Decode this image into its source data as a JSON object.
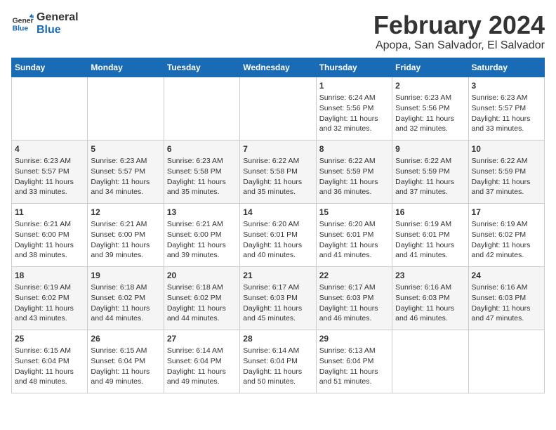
{
  "logo": {
    "line1": "General",
    "line2": "Blue"
  },
  "title": "February 2024",
  "subtitle": "Apopa, San Salvador, El Salvador",
  "days_of_week": [
    "Sunday",
    "Monday",
    "Tuesday",
    "Wednesday",
    "Thursday",
    "Friday",
    "Saturday"
  ],
  "weeks": [
    [
      {
        "day": "",
        "content": ""
      },
      {
        "day": "",
        "content": ""
      },
      {
        "day": "",
        "content": ""
      },
      {
        "day": "",
        "content": ""
      },
      {
        "day": "1",
        "content": "Sunrise: 6:24 AM\nSunset: 5:56 PM\nDaylight: 11 hours and 32 minutes."
      },
      {
        "day": "2",
        "content": "Sunrise: 6:23 AM\nSunset: 5:56 PM\nDaylight: 11 hours and 32 minutes."
      },
      {
        "day": "3",
        "content": "Sunrise: 6:23 AM\nSunset: 5:57 PM\nDaylight: 11 hours and 33 minutes."
      }
    ],
    [
      {
        "day": "4",
        "content": "Sunrise: 6:23 AM\nSunset: 5:57 PM\nDaylight: 11 hours and 33 minutes."
      },
      {
        "day": "5",
        "content": "Sunrise: 6:23 AM\nSunset: 5:57 PM\nDaylight: 11 hours and 34 minutes."
      },
      {
        "day": "6",
        "content": "Sunrise: 6:23 AM\nSunset: 5:58 PM\nDaylight: 11 hours and 35 minutes."
      },
      {
        "day": "7",
        "content": "Sunrise: 6:22 AM\nSunset: 5:58 PM\nDaylight: 11 hours and 35 minutes."
      },
      {
        "day": "8",
        "content": "Sunrise: 6:22 AM\nSunset: 5:59 PM\nDaylight: 11 hours and 36 minutes."
      },
      {
        "day": "9",
        "content": "Sunrise: 6:22 AM\nSunset: 5:59 PM\nDaylight: 11 hours and 37 minutes."
      },
      {
        "day": "10",
        "content": "Sunrise: 6:22 AM\nSunset: 5:59 PM\nDaylight: 11 hours and 37 minutes."
      }
    ],
    [
      {
        "day": "11",
        "content": "Sunrise: 6:21 AM\nSunset: 6:00 PM\nDaylight: 11 hours and 38 minutes."
      },
      {
        "day": "12",
        "content": "Sunrise: 6:21 AM\nSunset: 6:00 PM\nDaylight: 11 hours and 39 minutes."
      },
      {
        "day": "13",
        "content": "Sunrise: 6:21 AM\nSunset: 6:00 PM\nDaylight: 11 hours and 39 minutes."
      },
      {
        "day": "14",
        "content": "Sunrise: 6:20 AM\nSunset: 6:01 PM\nDaylight: 11 hours and 40 minutes."
      },
      {
        "day": "15",
        "content": "Sunrise: 6:20 AM\nSunset: 6:01 PM\nDaylight: 11 hours and 41 minutes."
      },
      {
        "day": "16",
        "content": "Sunrise: 6:19 AM\nSunset: 6:01 PM\nDaylight: 11 hours and 41 minutes."
      },
      {
        "day": "17",
        "content": "Sunrise: 6:19 AM\nSunset: 6:02 PM\nDaylight: 11 hours and 42 minutes."
      }
    ],
    [
      {
        "day": "18",
        "content": "Sunrise: 6:19 AM\nSunset: 6:02 PM\nDaylight: 11 hours and 43 minutes."
      },
      {
        "day": "19",
        "content": "Sunrise: 6:18 AM\nSunset: 6:02 PM\nDaylight: 11 hours and 44 minutes."
      },
      {
        "day": "20",
        "content": "Sunrise: 6:18 AM\nSunset: 6:02 PM\nDaylight: 11 hours and 44 minutes."
      },
      {
        "day": "21",
        "content": "Sunrise: 6:17 AM\nSunset: 6:03 PM\nDaylight: 11 hours and 45 minutes."
      },
      {
        "day": "22",
        "content": "Sunrise: 6:17 AM\nSunset: 6:03 PM\nDaylight: 11 hours and 46 minutes."
      },
      {
        "day": "23",
        "content": "Sunrise: 6:16 AM\nSunset: 6:03 PM\nDaylight: 11 hours and 46 minutes."
      },
      {
        "day": "24",
        "content": "Sunrise: 6:16 AM\nSunset: 6:03 PM\nDaylight: 11 hours and 47 minutes."
      }
    ],
    [
      {
        "day": "25",
        "content": "Sunrise: 6:15 AM\nSunset: 6:04 PM\nDaylight: 11 hours and 48 minutes."
      },
      {
        "day": "26",
        "content": "Sunrise: 6:15 AM\nSunset: 6:04 PM\nDaylight: 11 hours and 49 minutes."
      },
      {
        "day": "27",
        "content": "Sunrise: 6:14 AM\nSunset: 6:04 PM\nDaylight: 11 hours and 49 minutes."
      },
      {
        "day": "28",
        "content": "Sunrise: 6:14 AM\nSunset: 6:04 PM\nDaylight: 11 hours and 50 minutes."
      },
      {
        "day": "29",
        "content": "Sunrise: 6:13 AM\nSunset: 6:04 PM\nDaylight: 11 hours and 51 minutes."
      },
      {
        "day": "",
        "content": ""
      },
      {
        "day": "",
        "content": ""
      }
    ]
  ]
}
